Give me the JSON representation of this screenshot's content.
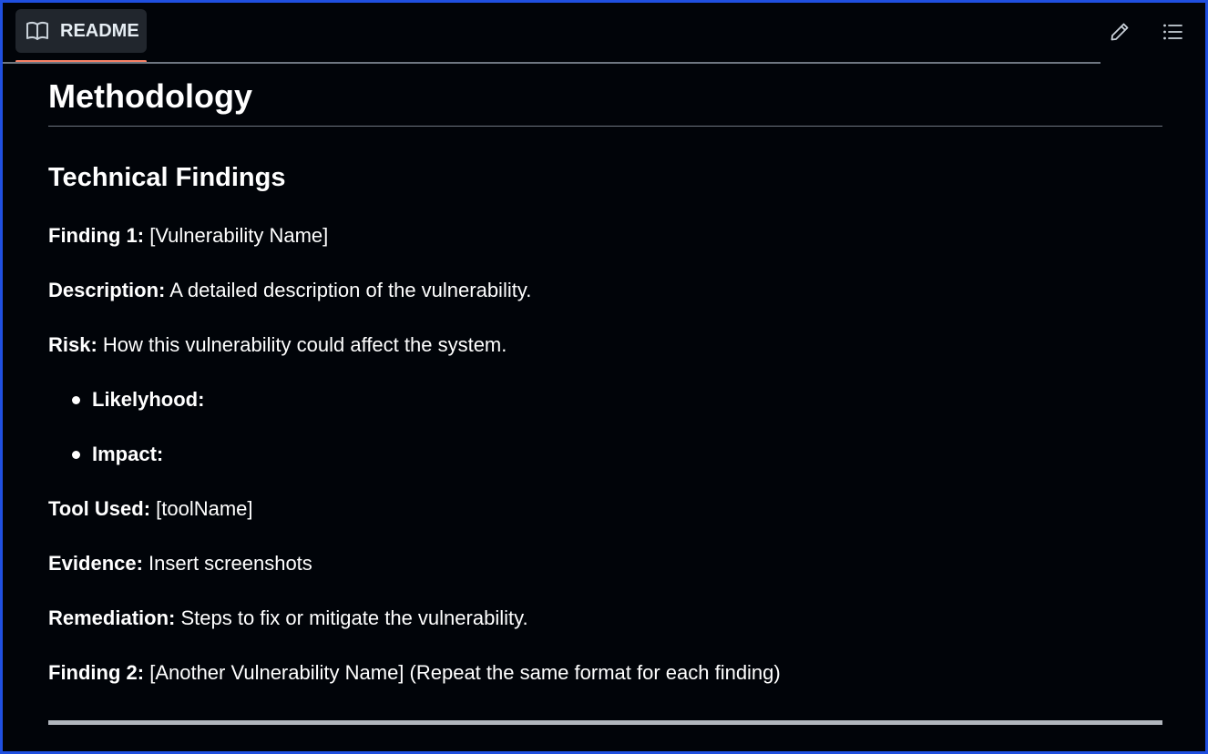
{
  "toolbar": {
    "tab_label": "README",
    "tab_icon": "book-icon",
    "edit_icon": "pencil-icon",
    "toc_icon": "list-icon",
    "accent": "#f78166"
  },
  "doc": {
    "h1": "Methodology",
    "h2": "Technical Findings",
    "finding1_label": "Finding 1:",
    "finding1_value": " [Vulnerability Name]",
    "description_label": "Description:",
    "description_value": " A detailed description of the vulnerability.",
    "risk_label": "Risk:",
    "risk_value": " How this vulnerability could affect the system.",
    "bullets": [
      "Likelyhood:",
      "Impact:"
    ],
    "tool_label": "Tool Used:",
    "tool_value": " [toolName]",
    "evidence_label": "Evidence:",
    "evidence_value": " Insert screenshots",
    "remediation_label": "Remediation:",
    "remediation_value": " Steps to fix or mitigate the vulnerability.",
    "finding2_label": "Finding 2:",
    "finding2_value": " [Another Vulnerability Name] (Repeat the same format for each finding)"
  }
}
